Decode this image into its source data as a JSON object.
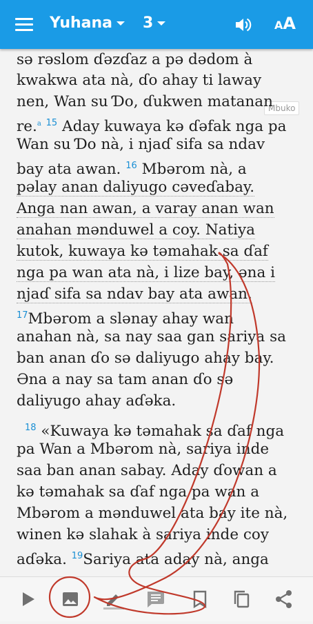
{
  "header": {
    "book": "Yuhana",
    "chapter": "3"
  },
  "note_label": "Mbuko",
  "lines": [
    "sə rəslom ɗəzɗaz a pə dədom à",
    "kwakwa ata nà, ɗo ahay ti laway",
    "nen, Wan su Ɗo, ɗukwen matanan",
    "re.",
    "Aday kuwaya kə ɗəfak nga pa",
    "Wan su Ɗo nà, i njaɗ sifa sa ndav",
    "bay ata awan.",
    "Mbərom nà, a",
    "pəlay anan daliyugo cəveɗabay.",
    "Anga nan awan, a varay anan wan",
    "anahan mənduwel a coy. Natiya",
    "kutok, kuwaya kə təmahak sa ɗaf",
    "nga pa wan ata nà, i lize bay, əna i",
    "njaɗ sifa sa ndav bay ata awan.",
    "Mbərom a slənay ahay wan",
    "anahan nà, sa nay saa gan sariya sa",
    "ban anan ɗo sə daliyugo ahay bay.",
    "Əna a nay sa tam anan ɗo sə",
    "daliyugo ahay aɗəka.",
    "«Kuwaya kə təmahak sa ɗaf nga",
    "pa Wan a Mbərom nà, sariya inde",
    "saa ban anan sabay. Aday ɗowan a",
    "kə təmahak sa ɗaf nga pa wan a",
    "Mbərom a mənduwel ata bay ite nà,",
    "winen kə slahak à sariya inde coy",
    "aɗəka.",
    "Sariya ata aday nà, anga"
  ],
  "footnote_mark": "a",
  "verses": {
    "v15": "15",
    "v16": "16",
    "v17": "17",
    "v18": "18",
    "v19": "19"
  },
  "colors": {
    "appbar": "#1a9be6",
    "accent": "#1a8fd4",
    "annotation": "#c0392b"
  },
  "bottom_icons": [
    "play-icon",
    "image-icon",
    "highlight-pen-icon",
    "comment-icon",
    "bookmark-icon",
    "copy-icon",
    "share-icon"
  ]
}
